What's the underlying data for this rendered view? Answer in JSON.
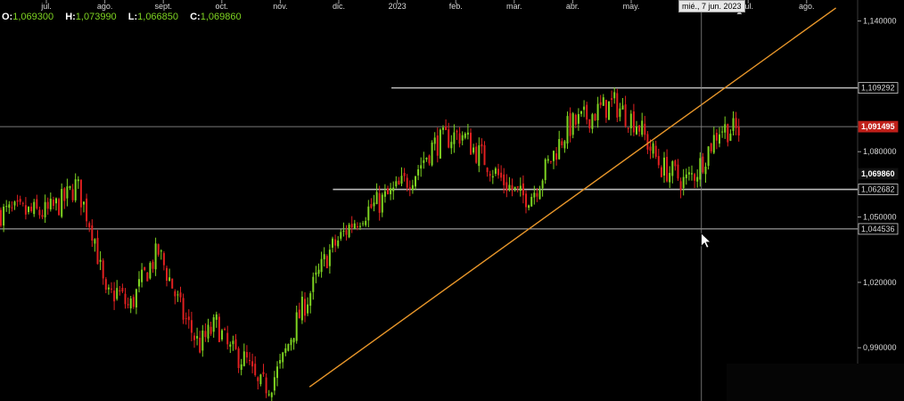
{
  "ohlc": {
    "o_label": "O:",
    "o_value": "1,069300",
    "h_label": "H:",
    "h_value": "1,073990",
    "l_label": "L:",
    "l_value": "1,066850",
    "c_label": "C:",
    "c_value": "1,069860"
  },
  "cursor": {
    "date_label": "mié., 7 jun. 2023"
  },
  "colors": {
    "background": "#000000",
    "bull": "#7ed321",
    "bear": "#e02020",
    "trendline": "#e8962a",
    "level": "#dcdcdc",
    "price_tag": "#c0201a",
    "axis_text": "#d8d8d8"
  },
  "chart_data": {
    "type": "candlestick",
    "instrument_note": "",
    "x_months": [
      "jul.",
      "ago.",
      "sept.",
      "oct.",
      "nov.",
      "dic.",
      "2023",
      "feb.",
      "mar.",
      "abr.",
      "may.",
      "jun.",
      "jul.",
      "ago."
    ],
    "x_tick_labels": [
      "jul.",
      "ago.",
      "sept.",
      "oct.",
      "nov.",
      "dic.",
      "2023",
      "feb.",
      "mar.",
      "abr.",
      "may.",
      "jul.",
      "ago."
    ],
    "y_ticks": [
      {
        "value": 1.14,
        "label": "1,140000"
      },
      {
        "value": 1.08,
        "label": "1,080000"
      },
      {
        "value": 1.05,
        "label": "1,050000"
      },
      {
        "value": 1.02,
        "label": "1,020000"
      },
      {
        "value": 0.99,
        "label": "0,990000"
      }
    ],
    "ylim": [
      0.968,
      1.148
    ],
    "close_series": [
      [
        0.0,
        1.052
      ],
      [
        0.3,
        1.058
      ],
      [
        0.5,
        1.065
      ],
      [
        0.8,
        1.042
      ],
      [
        1.0,
        1.012
      ],
      [
        1.2,
        1.016
      ],
      [
        1.4,
        1.008
      ],
      [
        1.7,
        1.025
      ],
      [
        1.9,
        1.034
      ],
      [
        2.1,
        1.021
      ],
      [
        2.3,
        1.006
      ],
      [
        2.6,
        0.991
      ],
      [
        2.9,
        1.001
      ],
      [
        3.1,
        0.989
      ],
      [
        3.4,
        0.984
      ],
      [
        3.6,
        0.972
      ],
      [
        3.8,
        0.973
      ],
      [
        4.0,
        0.982
      ],
      [
        4.2,
        0.998
      ],
      [
        4.4,
        1.01
      ],
      [
        4.6,
        1.021
      ],
      [
        4.8,
        1.033
      ],
      [
        5.0,
        1.04
      ],
      [
        5.2,
        1.047
      ],
      [
        5.4,
        1.052
      ],
      [
        5.7,
        1.057
      ],
      [
        6.0,
        1.063
      ],
      [
        6.3,
        1.071
      ],
      [
        6.6,
        1.083
      ],
      [
        6.9,
        1.087
      ],
      [
        7.1,
        1.088
      ],
      [
        7.3,
        1.081
      ],
      [
        7.5,
        1.076
      ],
      [
        7.7,
        1.069
      ],
      [
        7.9,
        1.064
      ],
      [
        8.1,
        1.059
      ],
      [
        8.3,
        1.061
      ],
      [
        8.5,
        1.071
      ],
      [
        8.7,
        1.081
      ],
      [
        8.9,
        1.091
      ],
      [
        9.1,
        1.094
      ],
      [
        9.3,
        1.097
      ],
      [
        9.5,
        1.1
      ],
      [
        9.7,
        1.102
      ],
      [
        9.9,
        1.097
      ],
      [
        10.1,
        1.093
      ],
      [
        10.3,
        1.082
      ],
      [
        10.5,
        1.073
      ],
      [
        10.7,
        1.07
      ],
      [
        10.9,
        1.066
      ],
      [
        11.1,
        1.071
      ],
      [
        11.3,
        1.081
      ],
      [
        11.5,
        1.091
      ],
      [
        11.7,
        1.09
      ],
      [
        11.85,
        1.0895
      ]
    ],
    "horizontal_levels": [
      {
        "value": 1.109292,
        "label": "1,109292",
        "start_month": 5.9,
        "style": "boxed"
      },
      {
        "value": 1.091495,
        "label": "1,091495",
        "start_month": 0.0,
        "style": "highlight"
      },
      {
        "value": 1.06986,
        "label": "1,069860",
        "start_month": null,
        "style": "tag"
      },
      {
        "value": 1.062682,
        "label": "1,062682",
        "start_month": 4.9,
        "style": "boxed"
      },
      {
        "value": 1.044536,
        "label": "1,044536",
        "start_month": 0.0,
        "style": "boxed"
      }
    ],
    "trendline": {
      "x0": 4.5,
      "y0": 0.972,
      "x1": 13.5,
      "y1": 1.146
    },
    "cursor_month": 11.2,
    "legend": "none",
    "grid": false
  }
}
